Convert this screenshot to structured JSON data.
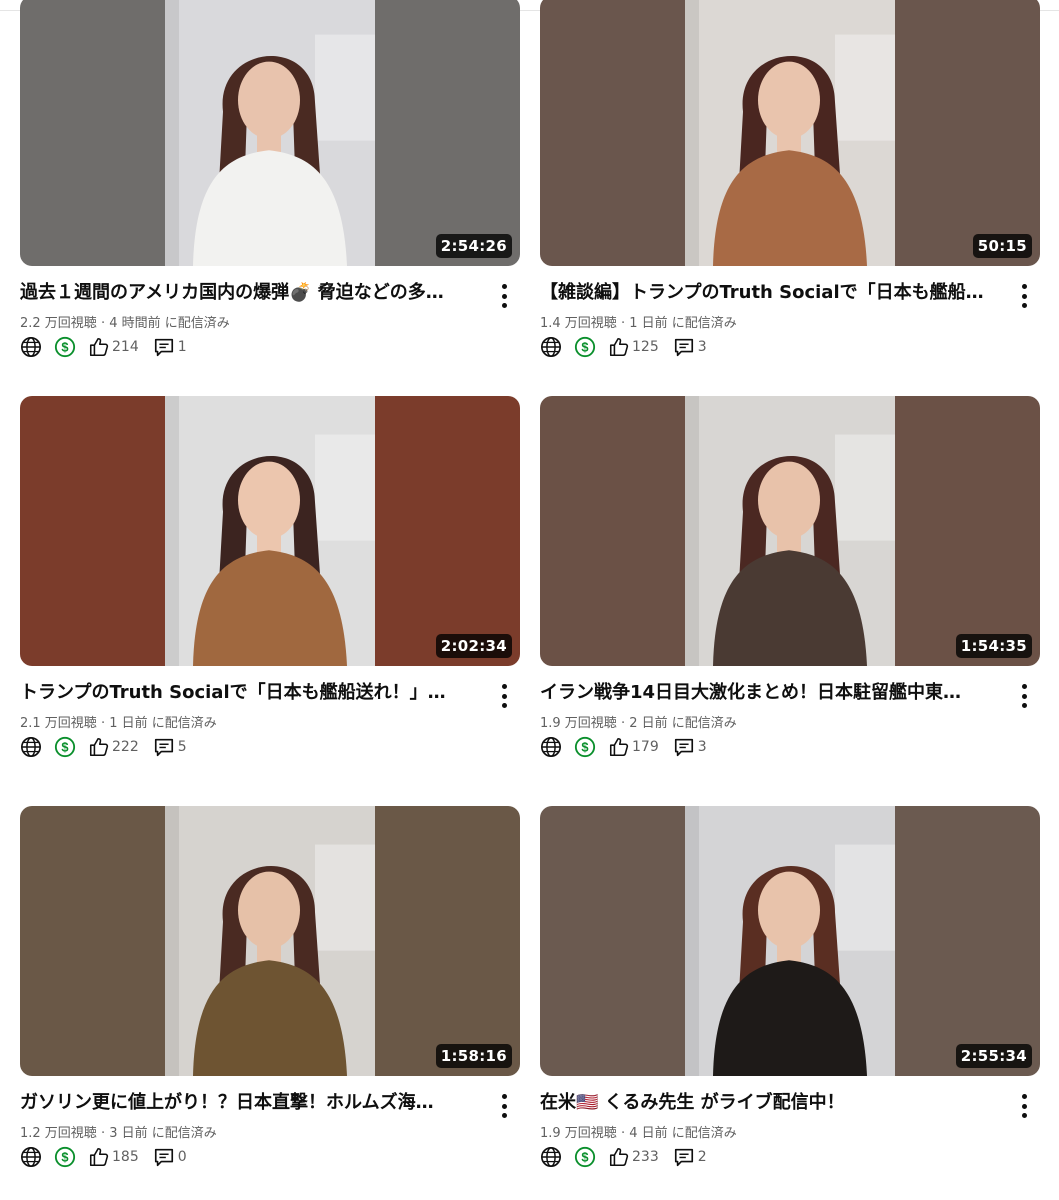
{
  "videos": [
    {
      "title": "過去１週間のアメリカ国内の爆弾💣 脅迫などの多…",
      "meta": "2.2 万回視聴 · 4 時間前 に配信済み",
      "duration": "2:54:26",
      "likes": "214",
      "comments": "1",
      "colors": {
        "side": "#6f6d6b",
        "wall": "#d9d9dc",
        "hair": "#4a2a22",
        "top": "#f2f2f0",
        "skin": "#e8c3ad"
      }
    },
    {
      "title": "【雑談編】トランプのTruth Socialで「日本も艦船…",
      "meta": "1.4 万回視聴 · 1 日前 に配信済み",
      "duration": "50:15",
      "likes": "125",
      "comments": "3",
      "colors": {
        "side": "#6a564d",
        "wall": "#dcd8d4",
        "hair": "#4a2620",
        "top": "#a86a45",
        "skin": "#e9c4ad"
      }
    },
    {
      "title": "トランプのTruth Socialで「日本も艦船送れ！」…",
      "meta": "2.1 万回視聴 · 1 日前 に配信済み",
      "duration": "2:02:34",
      "likes": "222",
      "comments": "5",
      "colors": {
        "side": "#7b3c2b",
        "wall": "#dedede",
        "hair": "#3c2420",
        "top": "#a0683f",
        "skin": "#ecc6ae"
      }
    },
    {
      "title": "イラン戦争14日目大激化まとめ！日本駐留艦中東…",
      "meta": "1.9 万回視聴 · 2 日前 に配信済み",
      "duration": "1:54:35",
      "likes": "179",
      "comments": "3",
      "colors": {
        "side": "#6b5146",
        "wall": "#d8d6d3",
        "hair": "#4b2822",
        "top": "#4a3a33",
        "skin": "#e8c2aa"
      }
    },
    {
      "title": "ガソリン更に値上がり！？日本直撃！ホルムズ海…",
      "meta": "1.2 万回視聴 · 3 日前 に配信済み",
      "duration": "1:58:16",
      "likes": "185",
      "comments": "0",
      "colors": {
        "side": "#6a5847",
        "wall": "#d6d3cf",
        "hair": "#4a2a22",
        "top": "#6e5432",
        "skin": "#e6c1a8"
      }
    },
    {
      "title": "在米🇺🇸 くるみ先生 がライブ配信中！",
      "meta": "1.9 万回視聴 · 4 日前 に配信済み",
      "duration": "2:55:34",
      "likes": "233",
      "comments": "2",
      "colors": {
        "side": "#6b5a50",
        "wall": "#d4d4d6",
        "hair": "#5a2e22",
        "top": "#1e1a18",
        "skin": "#e8c3ab"
      }
    }
  ]
}
